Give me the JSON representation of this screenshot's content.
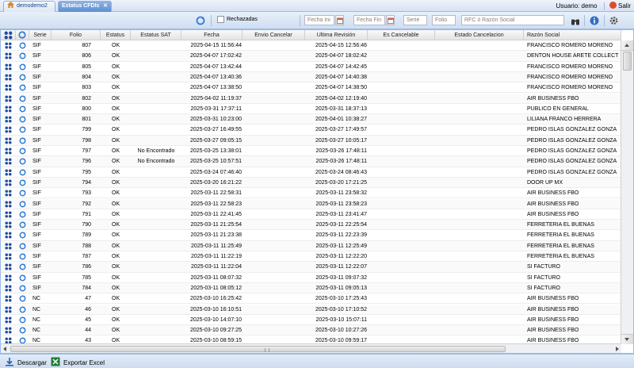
{
  "tabs": {
    "home": "demodemo2",
    "active": "Estatus CFDIs"
  },
  "user": {
    "label": "Usuario: demo",
    "exit": "Salir"
  },
  "toolbar": {
    "rechazadas_label": "Rechazadas",
    "fecha_ini_placeholder": "Fecha Ini",
    "fecha_fin_placeholder": "Fecha Fin",
    "serie_placeholder": "Serie",
    "folio_placeholder": "Folio",
    "rfc_placeholder": "RFC ó Razón Social"
  },
  "columns": [
    "Serie",
    "Folio",
    "Estatus",
    "Estatus SAT",
    "Fecha",
    "Envio Cancelar",
    "Ultima Revisión",
    "Es Cancelable",
    "Estado Cancelacion",
    "Razón Social"
  ],
  "rows": [
    {
      "serie": "SIF",
      "folio": "807",
      "estatus": "OK",
      "sat": "",
      "fecha": "2025-04-15 11:56:44",
      "envio": "",
      "revision": "2025-04-15 12:56:46",
      "cancelable": "",
      "estado": "",
      "razon": "FRANCISCO ROMERO MORENO"
    },
    {
      "serie": "SIF",
      "folio": "806",
      "estatus": "OK",
      "sat": "",
      "fecha": "2025-04-07 17:02:42",
      "envio": "",
      "revision": "2025-04-07 18:02:42",
      "cancelable": "",
      "estado": "",
      "razon": "DENTON HOUSE ARETE COLLECT"
    },
    {
      "serie": "SIF",
      "folio": "805",
      "estatus": "OK",
      "sat": "",
      "fecha": "2025-04-07 13:42:44",
      "envio": "",
      "revision": "2025-04-07 14:42:45",
      "cancelable": "",
      "estado": "",
      "razon": "FRANCISCO ROMERO MORENO"
    },
    {
      "serie": "SIF",
      "folio": "804",
      "estatus": "OK",
      "sat": "",
      "fecha": "2025-04-07 13:40:36",
      "envio": "",
      "revision": "2025-04-07 14:40:38",
      "cancelable": "",
      "estado": "",
      "razon": "FRANCISCO ROMERO MORENO"
    },
    {
      "serie": "SIF",
      "folio": "803",
      "estatus": "OK",
      "sat": "",
      "fecha": "2025-04-07 13:38:50",
      "envio": "",
      "revision": "2025-04-07 14:38:50",
      "cancelable": "",
      "estado": "",
      "razon": "FRANCISCO ROMERO MORENO"
    },
    {
      "serie": "SIF",
      "folio": "802",
      "estatus": "OK",
      "sat": "",
      "fecha": "2025-04-02 11:19:37",
      "envio": "",
      "revision": "2025-04-02 12:19:40",
      "cancelable": "",
      "estado": "",
      "razon": "AIR BUSINESS FBO"
    },
    {
      "serie": "SIF",
      "folio": "800",
      "estatus": "OK",
      "sat": "",
      "fecha": "2025-03-31 17:37:11",
      "envio": "",
      "revision": "2025-03-31 18:37:13",
      "cancelable": "",
      "estado": "",
      "razon": "PUBLICO EN GENERAL"
    },
    {
      "serie": "SIF",
      "folio": "801",
      "estatus": "OK",
      "sat": "",
      "fecha": "2025-03-31 10:23:00",
      "envio": "",
      "revision": "2025-04-01 10:38:27",
      "cancelable": "",
      "estado": "",
      "razon": "LILIANA FRANCO HERRERA"
    },
    {
      "serie": "SIF",
      "folio": "799",
      "estatus": "OK",
      "sat": "",
      "fecha": "2025-03-27 16:49:55",
      "envio": "",
      "revision": "2025-03-27 17:49:57",
      "cancelable": "",
      "estado": "",
      "razon": "PEDRO ISLAS GONZALEZ GONZA"
    },
    {
      "serie": "SIF",
      "folio": "798",
      "estatus": "OK",
      "sat": "",
      "fecha": "2025-03-27 09:05:15",
      "envio": "",
      "revision": "2025-03-27 10:05:17",
      "cancelable": "",
      "estado": "",
      "razon": "PEDRO ISLAS GONZALEZ GONZA"
    },
    {
      "serie": "SIF",
      "folio": "797",
      "estatus": "OK",
      "sat": "No Encontrado",
      "fecha": "2025-03-25 13:38:01",
      "envio": "",
      "revision": "2025-03-26 17:48:11",
      "cancelable": "",
      "estado": "",
      "razon": "PEDRO ISLAS GONZALEZ GONZA"
    },
    {
      "serie": "SIF",
      "folio": "796",
      "estatus": "OK",
      "sat": "No Encontrado",
      "fecha": "2025-03-25 10:57:51",
      "envio": "",
      "revision": "2025-03-26 17:48:11",
      "cancelable": "",
      "estado": "",
      "razon": "PEDRO ISLAS GONZALEZ GONZA"
    },
    {
      "serie": "SIF",
      "folio": "795",
      "estatus": "OK",
      "sat": "",
      "fecha": "2025-03-24 07:46:40",
      "envio": "",
      "revision": "2025-03-24 08:46:43",
      "cancelable": "",
      "estado": "",
      "razon": "PEDRO ISLAS GONZALEZ GONZA"
    },
    {
      "serie": "SIF",
      "folio": "794",
      "estatus": "OK",
      "sat": "",
      "fecha": "2025-03-20 16:21:22",
      "envio": "",
      "revision": "2025-03-20 17:21:25",
      "cancelable": "",
      "estado": "",
      "razon": "DOOR UP MX"
    },
    {
      "serie": "SIF",
      "folio": "793",
      "estatus": "OK",
      "sat": "",
      "fecha": "2025-03-11 22:58:31",
      "envio": "",
      "revision": "2025-03-11 23:58:32",
      "cancelable": "",
      "estado": "",
      "razon": "AIR BUSINESS FBO"
    },
    {
      "serie": "SIF",
      "folio": "792",
      "estatus": "OK",
      "sat": "",
      "fecha": "2025-03-11 22:58:23",
      "envio": "",
      "revision": "2025-03-11 23:58:23",
      "cancelable": "",
      "estado": "",
      "razon": "AIR BUSINESS FBO"
    },
    {
      "serie": "SIF",
      "folio": "791",
      "estatus": "OK",
      "sat": "",
      "fecha": "2025-03-11 22:41:45",
      "envio": "",
      "revision": "2025-03-11 23:41:47",
      "cancelable": "",
      "estado": "",
      "razon": "AIR BUSINESS FBO"
    },
    {
      "serie": "SIF",
      "folio": "790",
      "estatus": "OK",
      "sat": "",
      "fecha": "2025-03-11 21:25:54",
      "envio": "",
      "revision": "2025-03-11 22:25:54",
      "cancelable": "",
      "estado": "",
      "razon": "FERRETERIA EL BUENAS"
    },
    {
      "serie": "SIF",
      "folio": "789",
      "estatus": "OK",
      "sat": "",
      "fecha": "2025-03-11 21:23:38",
      "envio": "",
      "revision": "2025-03-11 22:23:39",
      "cancelable": "",
      "estado": "",
      "razon": "FERRETERIA EL BUENAS"
    },
    {
      "serie": "SIF",
      "folio": "788",
      "estatus": "OK",
      "sat": "",
      "fecha": "2025-03-11 11:25:49",
      "envio": "",
      "revision": "2025-03-11 12:25:49",
      "cancelable": "",
      "estado": "",
      "razon": "FERRETERIA EL BUENAS"
    },
    {
      "serie": "SIF",
      "folio": "787",
      "estatus": "OK",
      "sat": "",
      "fecha": "2025-03-11 11:22:19",
      "envio": "",
      "revision": "2025-03-11 12:22:20",
      "cancelable": "",
      "estado": "",
      "razon": "FERRETERIA EL BUENAS"
    },
    {
      "serie": "SIF",
      "folio": "786",
      "estatus": "OK",
      "sat": "",
      "fecha": "2025-03-11 11:22:04",
      "envio": "",
      "revision": "2025-03-11 12:22:07",
      "cancelable": "",
      "estado": "",
      "razon": "SI FACTURO"
    },
    {
      "serie": "SIF",
      "folio": "785",
      "estatus": "OK",
      "sat": "",
      "fecha": "2025-03-11 08:07:32",
      "envio": "",
      "revision": "2025-03-11 09:07:32",
      "cancelable": "",
      "estado": "",
      "razon": "SI FACTURO"
    },
    {
      "serie": "SIF",
      "folio": "784",
      "estatus": "OK",
      "sat": "",
      "fecha": "2025-03-11 08:05:12",
      "envio": "",
      "revision": "2025-03-11 09:05:13",
      "cancelable": "",
      "estado": "",
      "razon": "SI FACTURO"
    },
    {
      "serie": "NC",
      "folio": "47",
      "estatus": "OK",
      "sat": "",
      "fecha": "2025-03-10 16:25:42",
      "envio": "",
      "revision": "2025-03-10 17:25:43",
      "cancelable": "",
      "estado": "",
      "razon": "AIR BUSINESS FBO"
    },
    {
      "serie": "NC",
      "folio": "46",
      "estatus": "OK",
      "sat": "",
      "fecha": "2025-03-10 16:10:51",
      "envio": "",
      "revision": "2025-03-10 17:10:52",
      "cancelable": "",
      "estado": "",
      "razon": "AIR BUSINESS FBO"
    },
    {
      "serie": "NC",
      "folio": "45",
      "estatus": "OK",
      "sat": "",
      "fecha": "2025-03-10 14:07:10",
      "envio": "",
      "revision": "2025-03-10 15:07:11",
      "cancelable": "",
      "estado": "",
      "razon": "AIR BUSINESS FBO"
    },
    {
      "serie": "NC",
      "folio": "44",
      "estatus": "OK",
      "sat": "",
      "fecha": "2025-03-10 09:27:25",
      "envio": "",
      "revision": "2025-03-10 10:27:26",
      "cancelable": "",
      "estado": "",
      "razon": "AIR BUSINESS FBO"
    },
    {
      "serie": "NC",
      "folio": "43",
      "estatus": "OK",
      "sat": "",
      "fecha": "2025-03-10 08:59:15",
      "envio": "",
      "revision": "2025-03-10 09:59:17",
      "cancelable": "",
      "estado": "",
      "razon": "AIR BUSINESS FBO"
    }
  ],
  "bottom": {
    "descargar": "Descargar",
    "exportar": "Exportar Excel"
  },
  "colors": {
    "accent": "#5b8fd1",
    "header_border": "#99bbe8",
    "row_icon": "#1f4e9e"
  }
}
